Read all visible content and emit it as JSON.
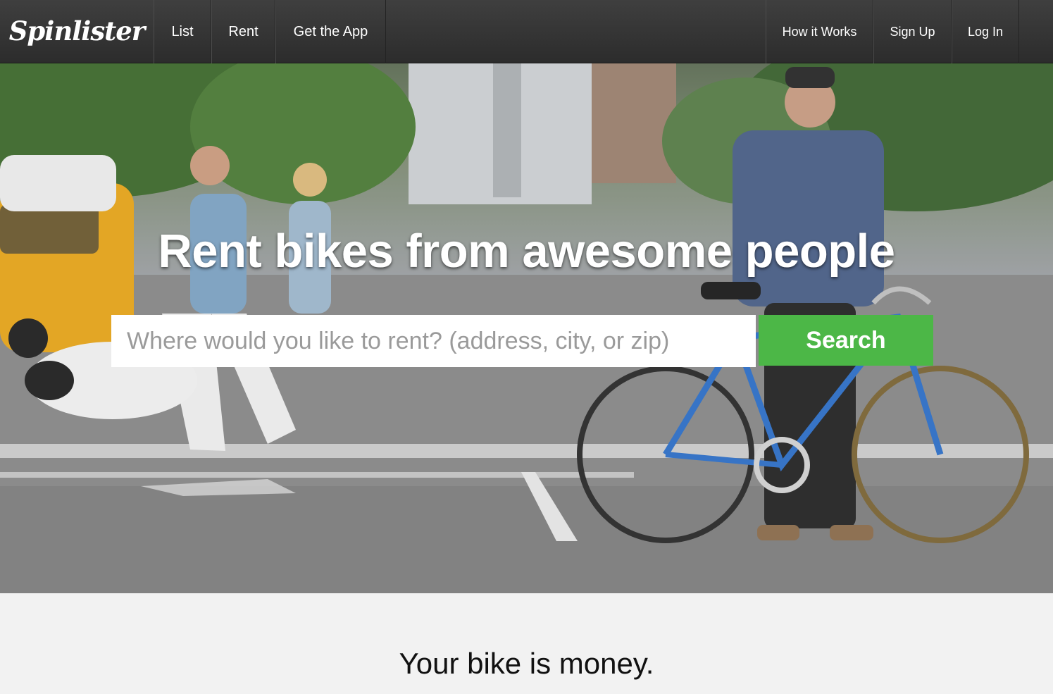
{
  "nav": {
    "logo": "Spinlister",
    "left_items": [
      "List",
      "Rent",
      "Get the App"
    ],
    "right_items": [
      "How it Works",
      "Sign Up",
      "Log In"
    ]
  },
  "hero": {
    "headline": "Rent bikes from awesome people",
    "search": {
      "placeholder": "Where would you like to rent? (address, city, or zip)",
      "value": "",
      "button_label": "Search"
    }
  },
  "section": {
    "tagline": "Your bike is money."
  },
  "colors": {
    "nav_bg": "#333333",
    "search_button": "#4cb747",
    "section_bg": "#f2f2f2"
  }
}
